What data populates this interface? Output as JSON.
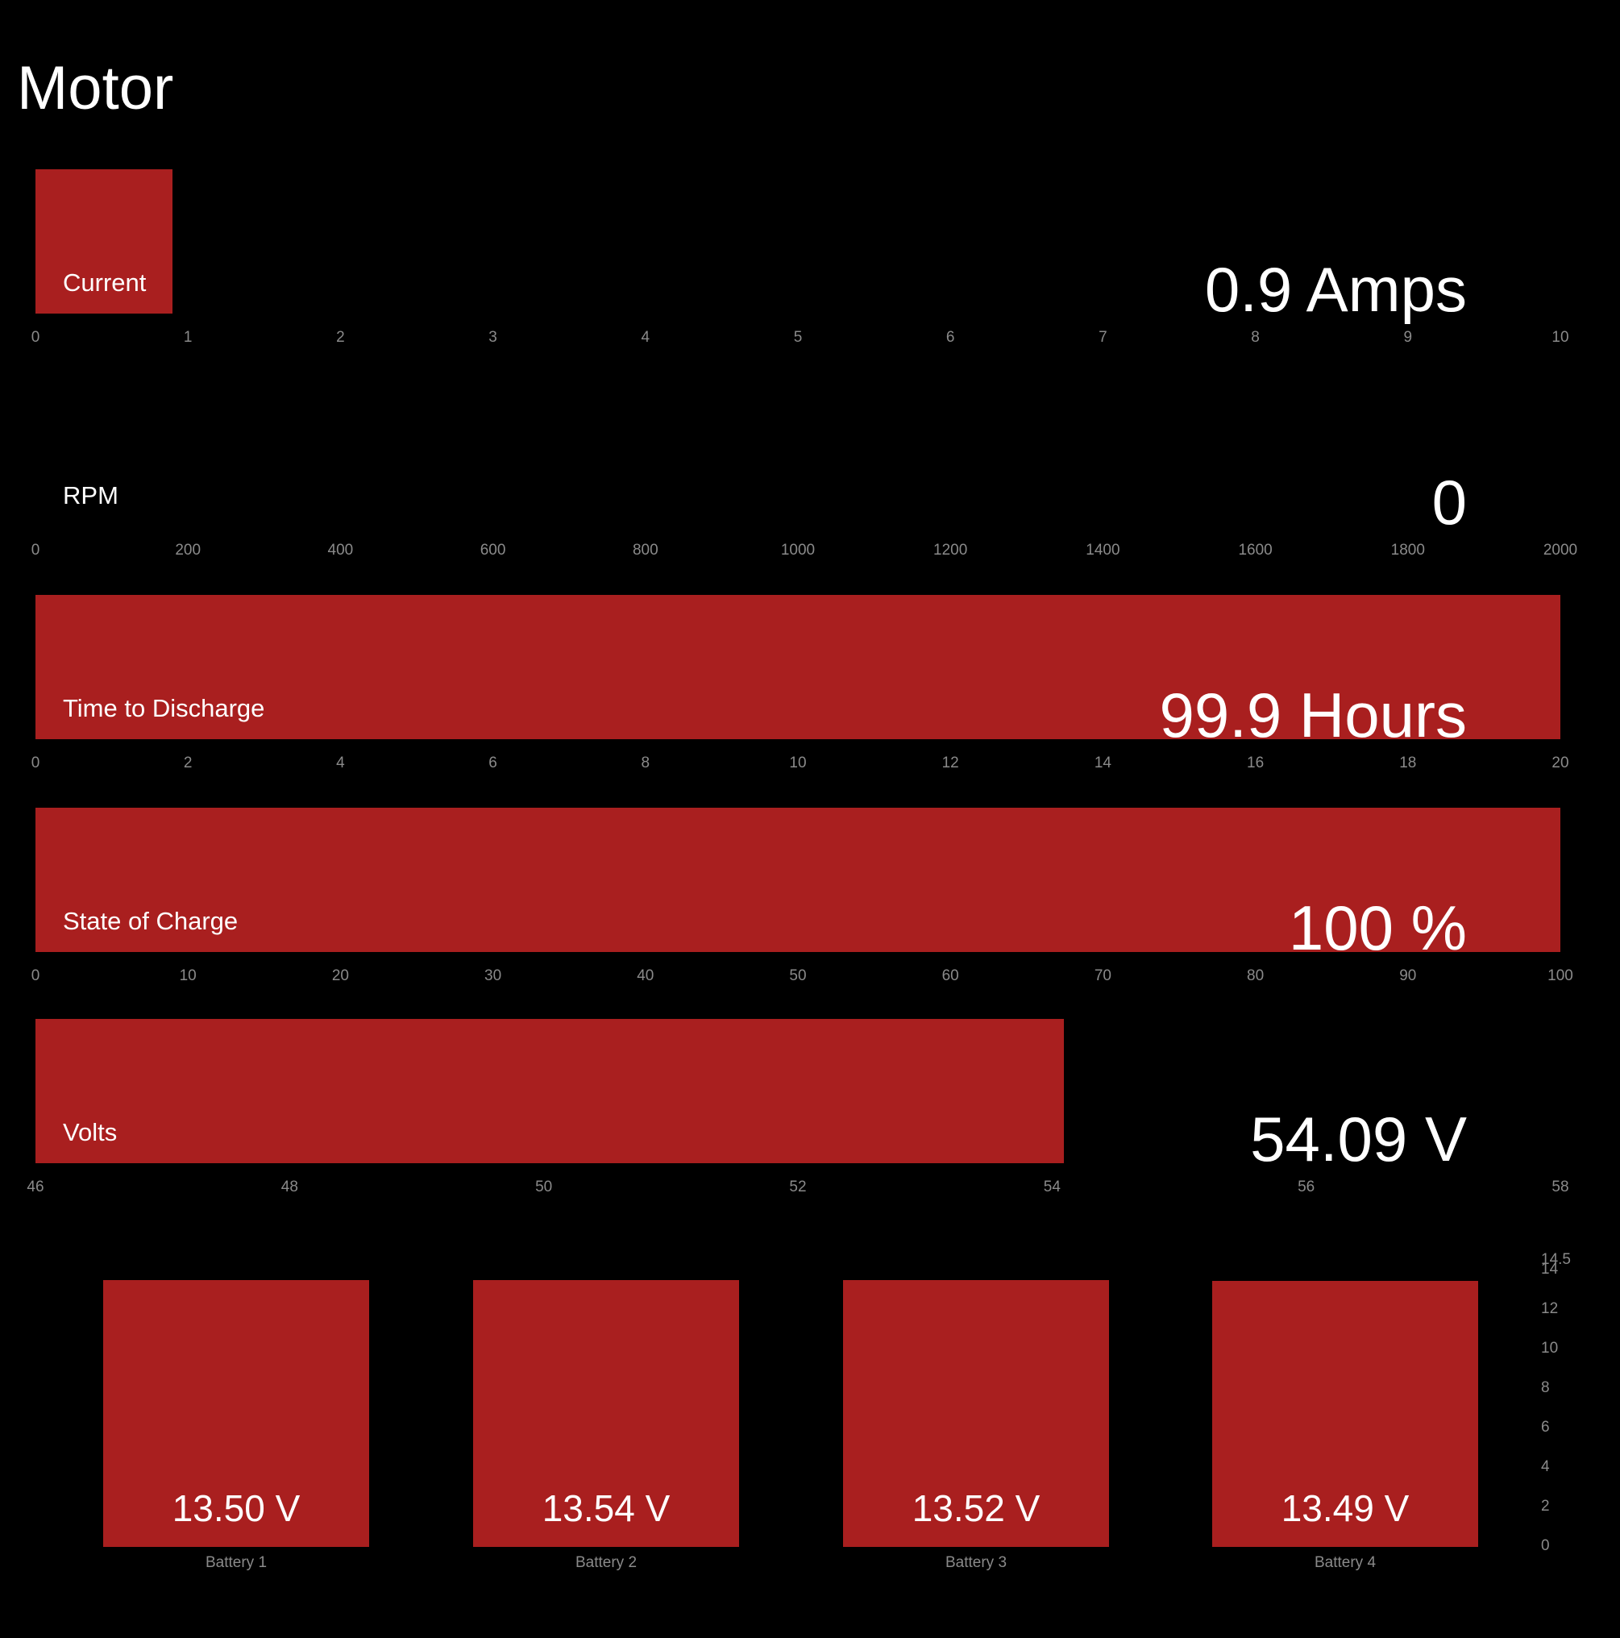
{
  "header": {
    "title": "Motor"
  },
  "colors": {
    "bar": "#a91f1f",
    "background": "#000000",
    "tick": "#8a8a8a"
  },
  "meters": [
    {
      "id": "current",
      "label": "Current",
      "value_text": "0.9 Amps",
      "value": 0.9,
      "min": 0,
      "max": 10,
      "ticks": [
        "0",
        "1",
        "2",
        "3",
        "4",
        "5",
        "6",
        "7",
        "8",
        "9",
        "10"
      ]
    },
    {
      "id": "rpm",
      "label": "RPM",
      "value_text": "0",
      "value": 0,
      "min": 0,
      "max": 2000,
      "ticks": [
        "0",
        "200",
        "400",
        "600",
        "800",
        "1000",
        "1200",
        "1400",
        "1600",
        "1800",
        "2000"
      ]
    },
    {
      "id": "discharge",
      "label": "Time to Discharge",
      "value_text": "99.9 Hours",
      "value": 20,
      "min": 0,
      "max": 20,
      "ticks": [
        "0",
        "2",
        "4",
        "6",
        "8",
        "10",
        "12",
        "14",
        "16",
        "18",
        "20"
      ]
    },
    {
      "id": "soc",
      "label": "State of Charge",
      "value_text": "100 %",
      "value": 100,
      "min": 0,
      "max": 100,
      "ticks": [
        "0",
        "10",
        "20",
        "30",
        "40",
        "50",
        "60",
        "70",
        "80",
        "90",
        "100"
      ]
    },
    {
      "id": "volts",
      "label": "Volts",
      "value_text": "54.09 V",
      "value": 54.09,
      "min": 46,
      "max": 58,
      "ticks": [
        "46",
        "48",
        "50",
        "52",
        "54",
        "56",
        "58"
      ]
    }
  ],
  "chart_data": {
    "type": "bar",
    "categories": [
      "Battery 1",
      "Battery 2",
      "Battery 3",
      "Battery 4"
    ],
    "values": [
      13.5,
      13.54,
      13.52,
      13.49
    ],
    "value_labels": [
      "13.50 V",
      "13.54 V",
      "13.52 V",
      "13.49 V"
    ],
    "ylim": [
      0,
      14.5
    ],
    "yticks": [
      "0",
      "2",
      "4",
      "6",
      "8",
      "10",
      "12",
      "14",
      "14.5"
    ]
  }
}
